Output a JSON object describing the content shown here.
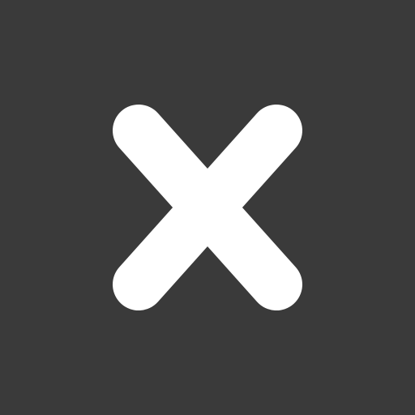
{
  "icon": {
    "name": "close-icon",
    "glyph": "x"
  },
  "colors": {
    "background": "#3a3a3a",
    "foreground": "#ffffff"
  }
}
